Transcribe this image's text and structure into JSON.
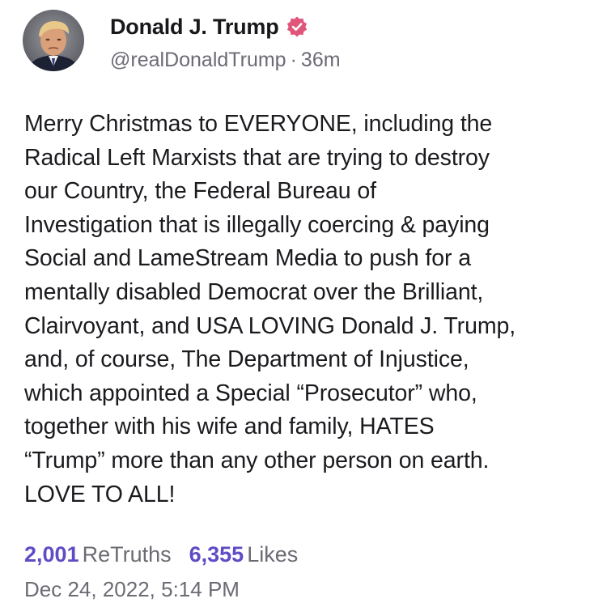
{
  "post": {
    "author": {
      "display_name": "Donald J. Trump",
      "handle": "@realDonaldTrump",
      "verified": true,
      "avatar_icon": "profile-photo"
    },
    "separator": "·",
    "age": "36m",
    "body": "Merry Christmas to EVERYONE, including the\nRadical Left Marxists that are trying to destroy\nour Country, the Federal Bureau of\nInvestigation that is illegally coercing & paying\nSocial and LameStream Media to push for a\nmentally disabled Democrat over the Brilliant,\nClairvoyant, and USA LOVING Donald J. Trump,\nand, of course, The Department of Injustice,\nwhich appointed a Special “Prosecutor” who,\ntogether with his wife and family, HATES\n“Trump” more than any other person on earth.\nLOVE TO ALL!",
    "stats": {
      "retruths_count": "2,001",
      "retruths_label": "ReTruths",
      "likes_count": "6,355",
      "likes_label": "Likes"
    },
    "timestamp": "Dec 24, 2022, 5:14 PM"
  },
  "colors": {
    "accent": "#5f4bc4",
    "verified_badge": "#e0567a",
    "muted_text": "#6b6b74",
    "body_text": "#1b1b1f"
  }
}
